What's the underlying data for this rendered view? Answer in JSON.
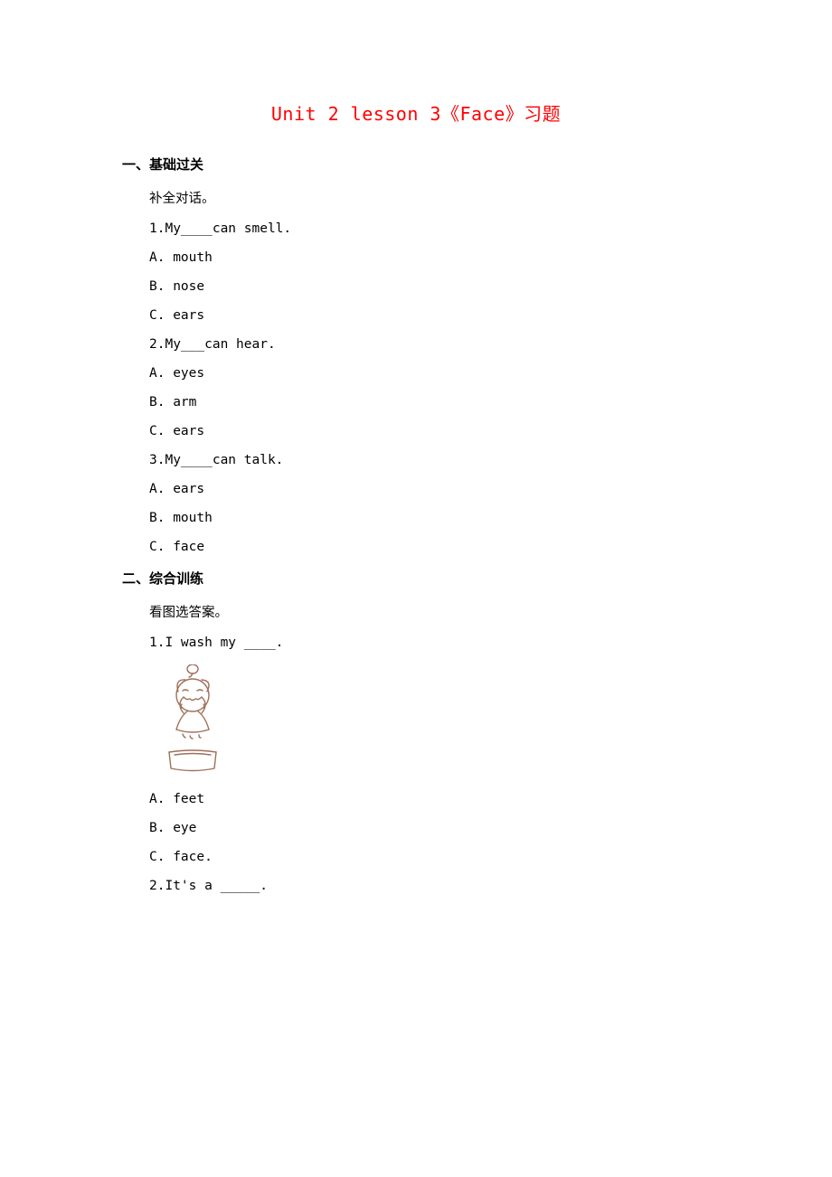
{
  "title": "Unit 2 lesson 3《Face》习题",
  "sections": [
    {
      "heading": "一、基础过关",
      "instruction": "补全对话。",
      "questions": [
        {
          "stem": "1.My____can smell.",
          "options": [
            "A. mouth",
            "B. nose",
            "C. ears"
          ]
        },
        {
          "stem": "2.My___can hear.",
          "options": [
            "A. eyes",
            "B. arm",
            "C. ears"
          ]
        },
        {
          "stem": "3.My____can talk.",
          "options": [
            "A. ears",
            "B. mouth",
            "C. face"
          ]
        }
      ]
    },
    {
      "heading": "二、综合训练",
      "instruction": "看图选答案。",
      "questions": [
        {
          "stem": "1.I wash my ____.",
          "image": "girl-washing-face",
          "options": [
            "A. feet",
            "B. eye",
            "C. face."
          ]
        },
        {
          "stem": "2.It's a _____."
        }
      ]
    }
  ]
}
